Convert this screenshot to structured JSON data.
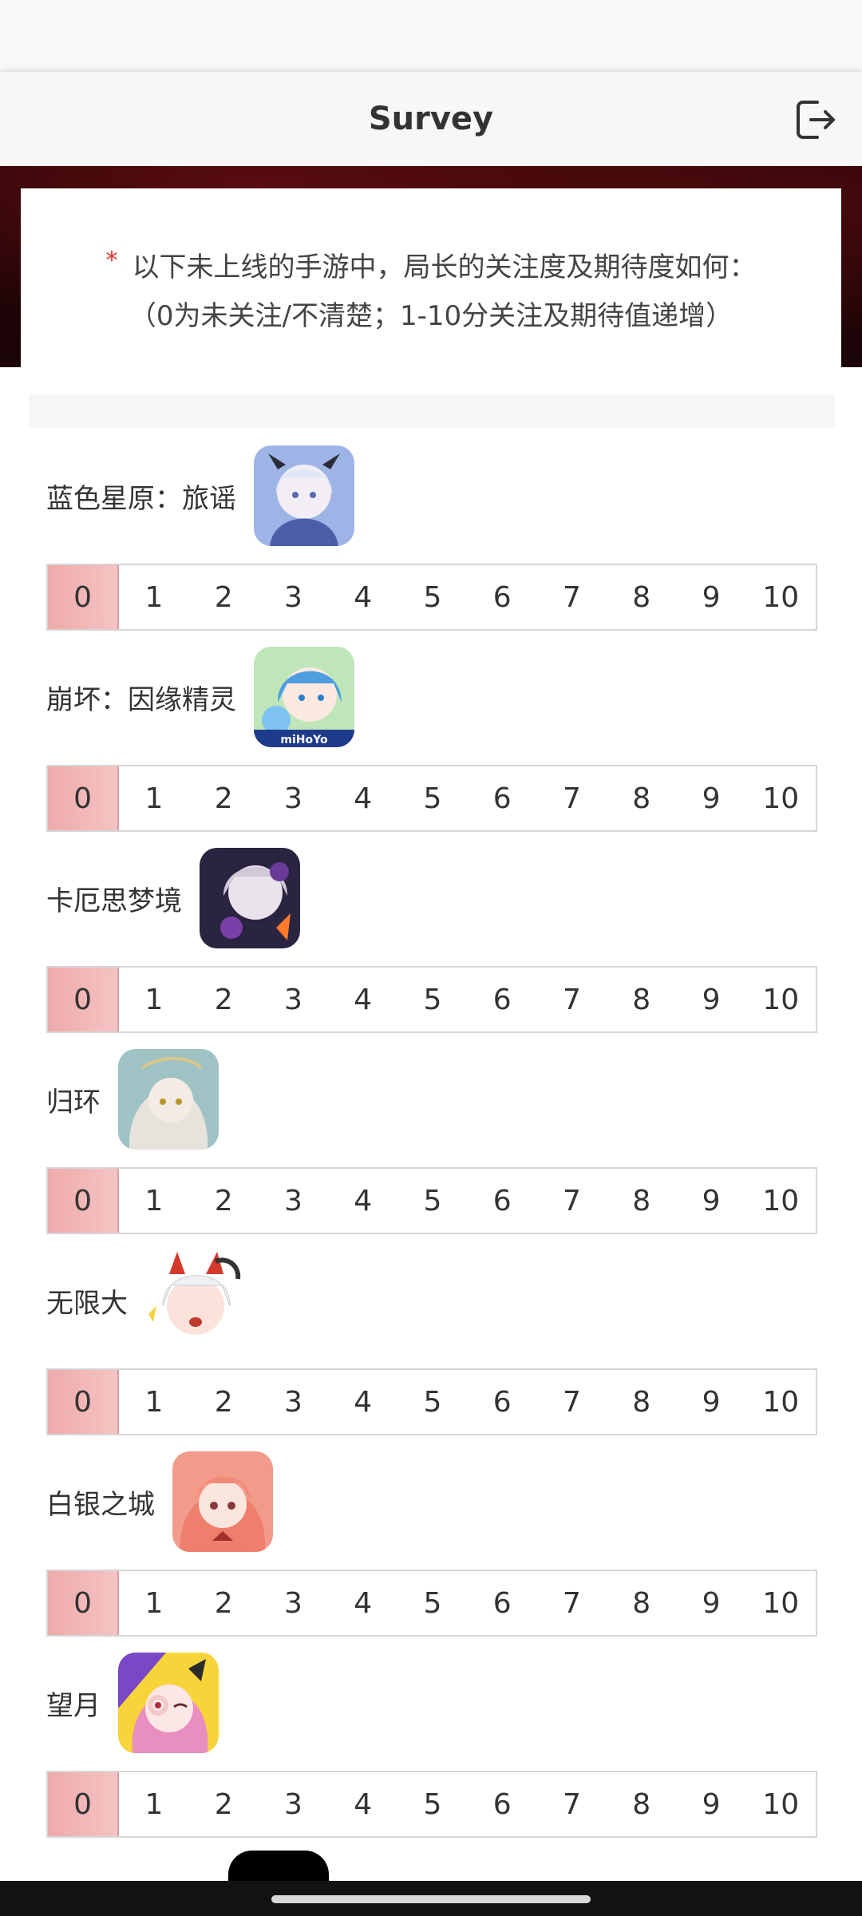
{
  "header": {
    "title": "Survey"
  },
  "question": {
    "required_mark": "*",
    "text": "以下未上线的手游中，局长的关注度及期待度如何：",
    "note": "（0为未关注/不清楚；1-10分关注及期待值递增）"
  },
  "scale": {
    "options": [
      "0",
      "1",
      "2",
      "3",
      "4",
      "5",
      "6",
      "7",
      "8",
      "9",
      "10"
    ],
    "selected_value": 0
  },
  "games": [
    {
      "name": "蓝色星原：旅谣",
      "icon": "game-icon-blue-horizon",
      "selected": 0
    },
    {
      "name": "崩坏：因缘精灵",
      "icon": "game-icon-honkai-spirits",
      "selected": 0
    },
    {
      "name": "卡厄思梦境",
      "icon": "game-icon-chaos-zero",
      "selected": 0
    },
    {
      "name": "归环",
      "icon": "game-icon-guihuan",
      "selected": 0
    },
    {
      "name": "无限大",
      "icon": "game-icon-ananta",
      "selected": 0
    },
    {
      "name": "白银之城",
      "icon": "game-icon-silver-city",
      "selected": 0
    },
    {
      "name": "望月",
      "icon": "game-icon-wangyue",
      "selected": 0
    }
  ],
  "colors": {
    "selected_fill": "#f2b5b5",
    "banner": "#2a0608",
    "required": "#dd3333"
  }
}
